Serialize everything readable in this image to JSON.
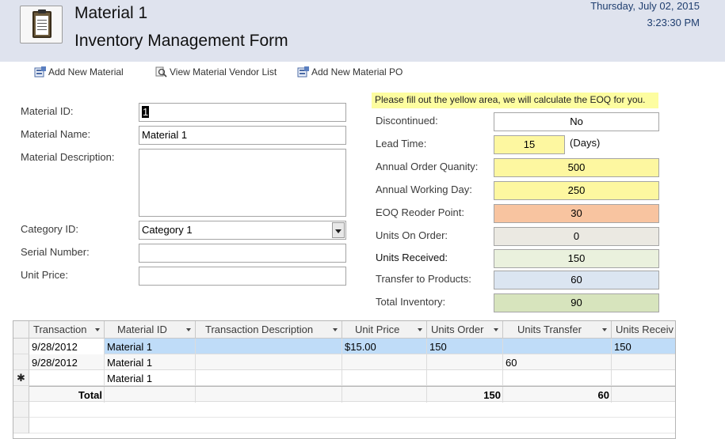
{
  "header": {
    "title": "Material 1",
    "subtitle": "Inventory Management Form",
    "date": "Thursday, July 02, 2015",
    "time": "3:23:30 PM"
  },
  "toolbar": {
    "add_material": "Add New Material",
    "view_vendor": "View Material Vendor List",
    "add_po": "Add New Material PO"
  },
  "left_form": {
    "material_id_label": "Material ID:",
    "material_id_value": "1",
    "material_name_label": "Material Name:",
    "material_name_value": "Material 1",
    "material_desc_label": "Material Description:",
    "material_desc_value": "",
    "category_label": "Category ID:",
    "category_value": "Category 1",
    "serial_label": "Serial Number:",
    "serial_value": "",
    "price_label": "Unit Price:",
    "price_value": ""
  },
  "right_form": {
    "note": "Please fill out the yellow area, we will calculate the EOQ for you.",
    "discontinued_label": "Discontinued:",
    "discontinued_value": "No",
    "lead_time_label": "Lead Time:",
    "lead_time_value": "15",
    "lead_time_unit": "(Days)",
    "annual_order_label": "Annual Order Quanity:",
    "annual_order_value": "500",
    "working_day_label": "Annual Working Day:",
    "working_day_value": "250",
    "eoq_label": "EOQ Reoder Point:",
    "eoq_value": "30",
    "units_on_order_label": "Units On Order:",
    "units_on_order_value": "0",
    "units_received_label": "Units Received:",
    "units_received_value": "150",
    "transfer_label": "Transfer to Products:",
    "transfer_value": "60",
    "total_inventory_label": "Total Inventory:",
    "total_inventory_value": "90"
  },
  "grid": {
    "columns": [
      "Transaction",
      "Material ID",
      "Transaction Description",
      "Unit Price",
      "Units Order",
      "Units Transfer",
      "Units Receiv"
    ],
    "rows": [
      {
        "transaction": "9/28/2012",
        "material": "Material 1",
        "desc": "",
        "price": "$15.00",
        "order": "150",
        "transfer": "",
        "received": "150"
      },
      {
        "transaction": "9/28/2012",
        "material": "Material 1",
        "desc": "",
        "price": "",
        "order": "",
        "transfer": "60",
        "received": ""
      }
    ],
    "new_row_marker": "✱",
    "new_row_material": "Material 1",
    "total_label": "Total",
    "total_order": "150",
    "total_transfer": "60"
  },
  "colors": {
    "header_bg": "#dfe3ee",
    "yellow": "#fdf7a0",
    "orange": "#f8c4a0",
    "active_row": "#bfdcf8"
  }
}
